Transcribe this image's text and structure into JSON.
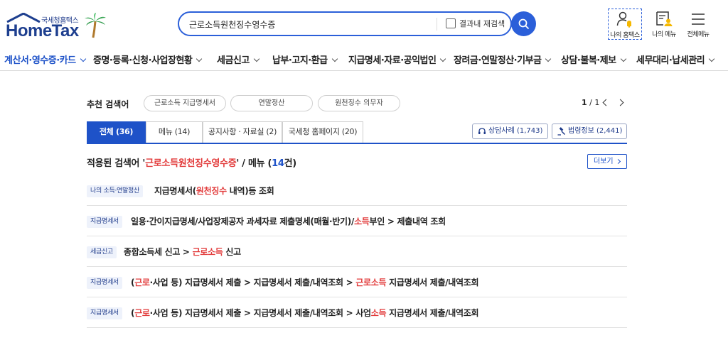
{
  "logo": {
    "sub": "국세청홈택스",
    "main": "HomeTax"
  },
  "search": {
    "value": "근로소득원천징수영수증",
    "checkbox_label": "결과내 재검색"
  },
  "quick": [
    {
      "label": "나의 홈택스",
      "icon": "user-bell-icon"
    },
    {
      "label": "나의 메뉴",
      "icon": "user-doc-icon"
    },
    {
      "label": "전체메뉴",
      "icon": "hamburger-icon"
    }
  ],
  "nav": [
    "계산서·영수증·카드",
    "증명·등록·신청·사업장현황",
    "세금신고",
    "납부·고지·환급",
    "지급명세·자료·공익법인",
    "장려금·연말정산·기부금",
    "상담·불복·제보",
    "세무대리·납세관리"
  ],
  "recommend": {
    "label": "추천 검색어",
    "chips": [
      "근로소득 지급명세서",
      "연말정산",
      "원천징수 의무자"
    ],
    "page_current": "1",
    "page_total": "/ 1"
  },
  "tabs": [
    "전체 (36)",
    "메뉴 (14)",
    "공지사항 · 자료실 (2)",
    "국세청 홈페이지 (20)"
  ],
  "side_buttons": [
    "상담사례 (1,743)",
    "법령정보 (2,441)"
  ],
  "applied": {
    "prefix": "적용된 검색어 '",
    "keyword": "근로소득원천징수영수증",
    "mid": "' / 메뉴 (",
    "count": "14",
    "suffix": "건)",
    "more": "더보기"
  },
  "results": [
    {
      "tag": "나의 소득·연말정산",
      "parts": [
        [
          "지급명세서(",
          false
        ],
        [
          "원천징수",
          true
        ],
        [
          " 내역)등 조회",
          false
        ]
      ]
    },
    {
      "tag": "지급명세서",
      "parts": [
        [
          "일용·간이지급명세/사업장제공자 과세자료 제출명세(매월·반기)/",
          false
        ],
        [
          "소득",
          true
        ],
        [
          "부인 > 제출내역 조회",
          false
        ]
      ]
    },
    {
      "tag": "세금신고",
      "parts": [
        [
          "종합소득세 신고 > ",
          false
        ],
        [
          "근로소득",
          true
        ],
        [
          " 신고",
          false
        ]
      ]
    },
    {
      "tag": "지급명세서",
      "parts": [
        [
          "(",
          false
        ],
        [
          "근로",
          true
        ],
        [
          "·사업 등) 지급명세서 제출 > 지급명세서 제출/내역조회 > ",
          false
        ],
        [
          "근로소득",
          true
        ],
        [
          " 지급명세서 제출/내역조회",
          false
        ]
      ]
    },
    {
      "tag": "지급명세서",
      "parts": [
        [
          "(",
          false
        ],
        [
          "근로",
          true
        ],
        [
          "·사업 등) 지급명세서 제출 > 지급명세서 제출/내역조회 > 사업",
          false
        ],
        [
          "소득",
          true
        ],
        [
          " 지급명세서 제출/내역조회",
          false
        ]
      ]
    }
  ]
}
